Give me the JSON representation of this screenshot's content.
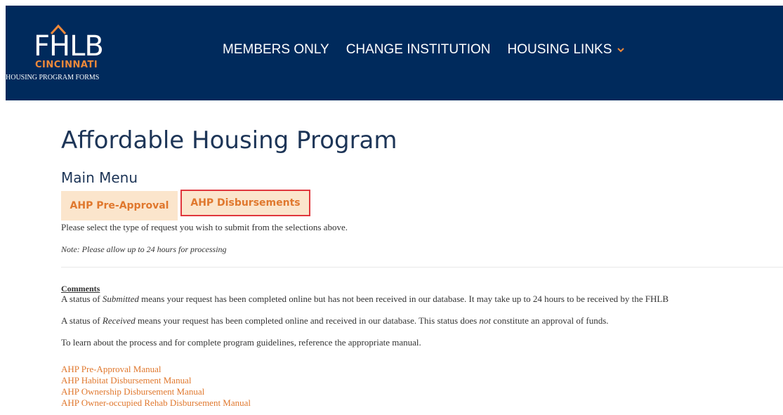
{
  "header": {
    "logo": {
      "mark": "FHLB",
      "city": "CINCINNATI",
      "subtitle": "HOUSING PROGRAM FORMS"
    },
    "nav": [
      {
        "label": "MEMBERS ONLY"
      },
      {
        "label": "CHANGE INSTITUTION"
      },
      {
        "label": "HOUSING LINKS",
        "icon": "chevron-down-icon"
      }
    ],
    "colors": {
      "background": "#002a5c",
      "accent": "#f08a3a"
    }
  },
  "main": {
    "title": "Affordable Housing Program",
    "subtitle": "Main Menu",
    "tabs": [
      {
        "label": "AHP Pre-Approval"
      },
      {
        "label": "AHP Disbursements",
        "highlighted": true
      }
    ],
    "instruction": "Please select the type of request you wish to submit from the selections above.",
    "note": "Note: Please allow up to 24 hours for processing"
  },
  "comments": {
    "heading": "Comments",
    "submitted": {
      "prefix": "A status of ",
      "term": "Submitted",
      "suffix": " means your request has been completed online but has not been received in our database. It may take up to 24 hours to be received by the FHLB"
    },
    "received": {
      "prefix": "A status of ",
      "term": "Received",
      "middle": " means your request has been completed online and received in our database. This status does ",
      "emphasis": "not",
      "suffix": " constitute an approval of funds."
    },
    "guidelines": "To learn about the process and for complete program guidelines, reference the appropriate manual."
  },
  "manuals": [
    "AHP Pre-Approval Manual",
    "AHP Habitat Disbursement Manual",
    "AHP Ownership Disbursement Manual",
    "AHP Owner-occupied Rehab Disbursement Manual"
  ]
}
